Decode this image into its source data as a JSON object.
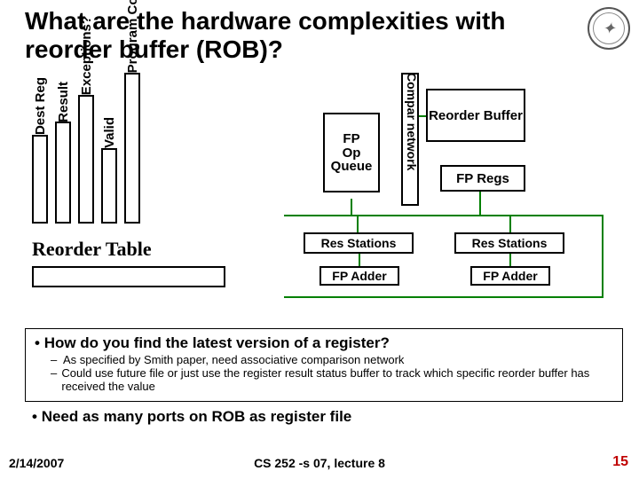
{
  "title": "What are the hardware complexities with reorder buffer (ROB)?",
  "table_columns": {
    "dest_reg": "Dest Reg",
    "result": "Result",
    "exceptions": "Exceptions?",
    "valid": "Valid",
    "program_counter": "Program Counter"
  },
  "reorder_table_label": "Reorder Table",
  "diagram": {
    "fp_op_queue": "FP\nOp\nQueue",
    "compar_network": "Compar network",
    "reorder_buffer": "Reorder Buffer",
    "fp_regs": "FP Regs",
    "res_stations": "Res Stations",
    "fp_adder": "FP Adder"
  },
  "bullets": {
    "q1": "How do you find the latest version of a register?",
    "sub1": "As specified by Smith paper, need associative comparison network",
    "sub2": "Could use future file or just use the register result status buffer to track which specific reorder buffer has received the value",
    "q2": "Need as many ports on ROB as register file"
  },
  "footer": {
    "date": "2/14/2007",
    "course": "CS 252 -s 07, lecture 8",
    "page": "15"
  }
}
